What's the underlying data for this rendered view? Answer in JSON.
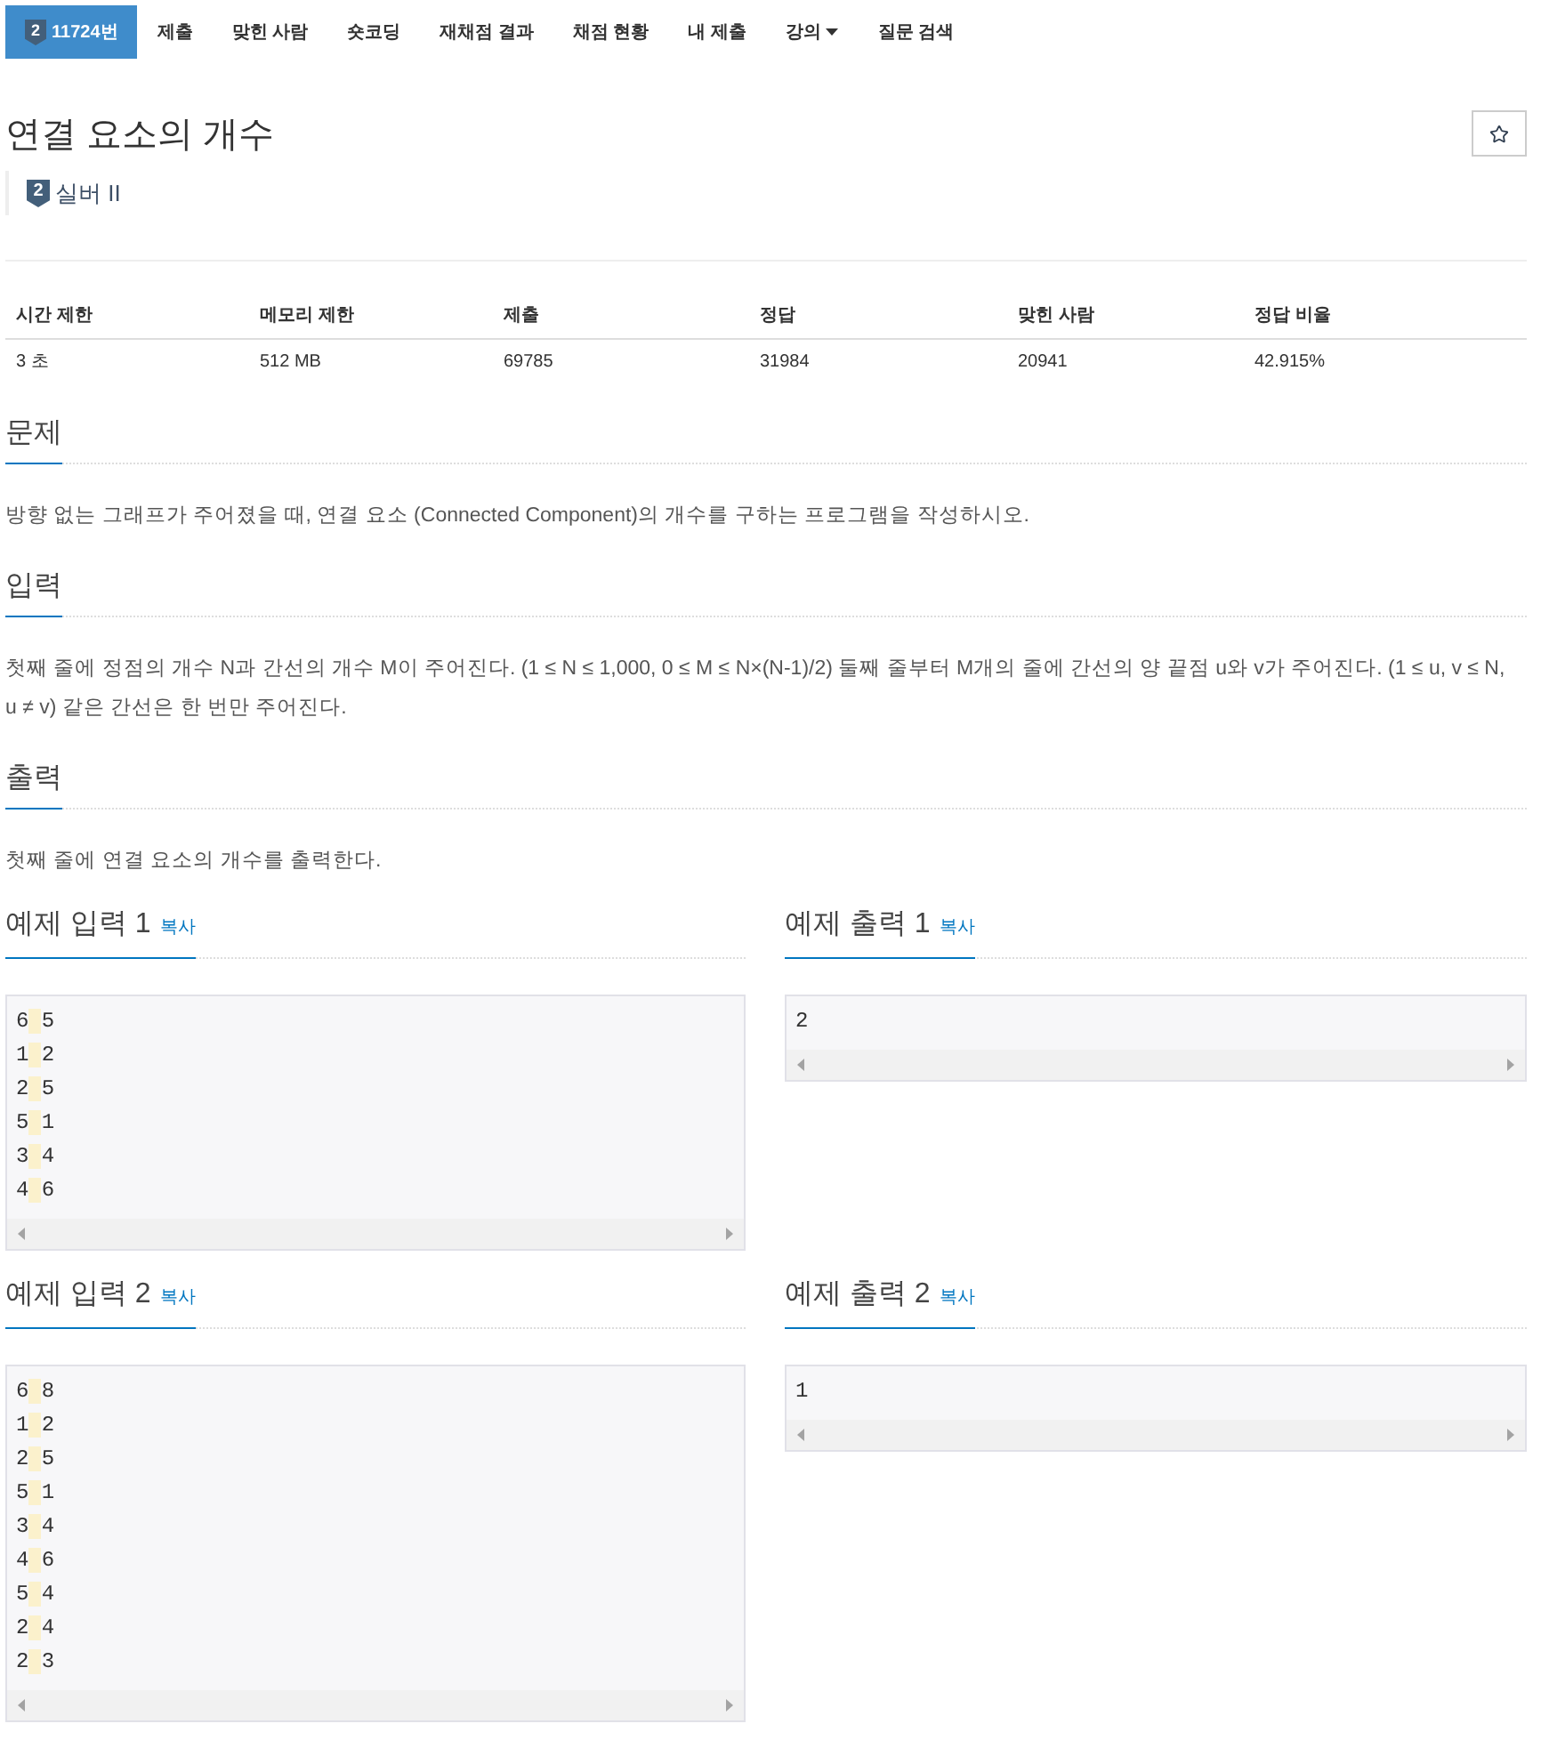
{
  "nav": {
    "tabs": [
      {
        "label": "11724번",
        "badge": "2",
        "selected": true,
        "dropdown": false
      },
      {
        "label": "제출",
        "selected": false,
        "dropdown": false
      },
      {
        "label": "맞힌 사람",
        "selected": false,
        "dropdown": false
      },
      {
        "label": "숏코딩",
        "selected": false,
        "dropdown": false
      },
      {
        "label": "재채점 결과",
        "selected": false,
        "dropdown": false
      },
      {
        "label": "채점 현황",
        "selected": false,
        "dropdown": false
      },
      {
        "label": "내 제출",
        "selected": false,
        "dropdown": false
      },
      {
        "label": "강의",
        "selected": false,
        "dropdown": true
      },
      {
        "label": "질문 검색",
        "selected": false,
        "dropdown": false
      }
    ]
  },
  "problem": {
    "title": "연결 요소의 개수",
    "starred": false,
    "tier": {
      "badge": "2",
      "label": "실버 II"
    }
  },
  "stats": {
    "columns": [
      "시간 제한",
      "메모리 제한",
      "제출",
      "정답",
      "맞힌 사람",
      "정답 비율"
    ],
    "rows": [
      [
        "3 초",
        "512 MB",
        "69785",
        "31984",
        "20941",
        "42.915%"
      ]
    ]
  },
  "sections": [
    {
      "heading": "문제",
      "text": "방향 없는 그래프가 주어졌을 때, 연결 요소 (Connected Component)의 개수를 구하는 프로그램을 작성하시오."
    },
    {
      "heading": "입력",
      "text": "첫째 줄에 정점의 개수 N과 간선의 개수 M이 주어진다. (1 ≤ N ≤ 1,000, 0 ≤ M ≤ N×(N-1)/2) 둘째 줄부터 M개의 줄에 간선의 양 끝점 u와 v가 주어진다. (1 ≤ u, v ≤ N, u ≠ v) 같은 간선은 한 번만 주어진다."
    },
    {
      "heading": "출력",
      "text": "첫째 줄에 연결 요소의 개수를 출력한다."
    }
  ],
  "samples": [
    {
      "heading": "예제 입력 1",
      "copy": "복사",
      "lines": [
        "6 5",
        "1 2",
        "2 5",
        "5 1",
        "3 4",
        "4 6"
      ]
    },
    {
      "heading": "예제 출력 1",
      "copy": "복사",
      "lines": [
        "2"
      ]
    },
    {
      "heading": "예제 입력 2",
      "copy": "복사",
      "lines": [
        "6 8",
        "1 2",
        "2 5",
        "5 1",
        "3 4",
        "4 6",
        "5 4",
        "2 4",
        "2 3"
      ]
    },
    {
      "heading": "예제 출력 2",
      "copy": "복사",
      "lines": [
        "1"
      ]
    }
  ]
}
